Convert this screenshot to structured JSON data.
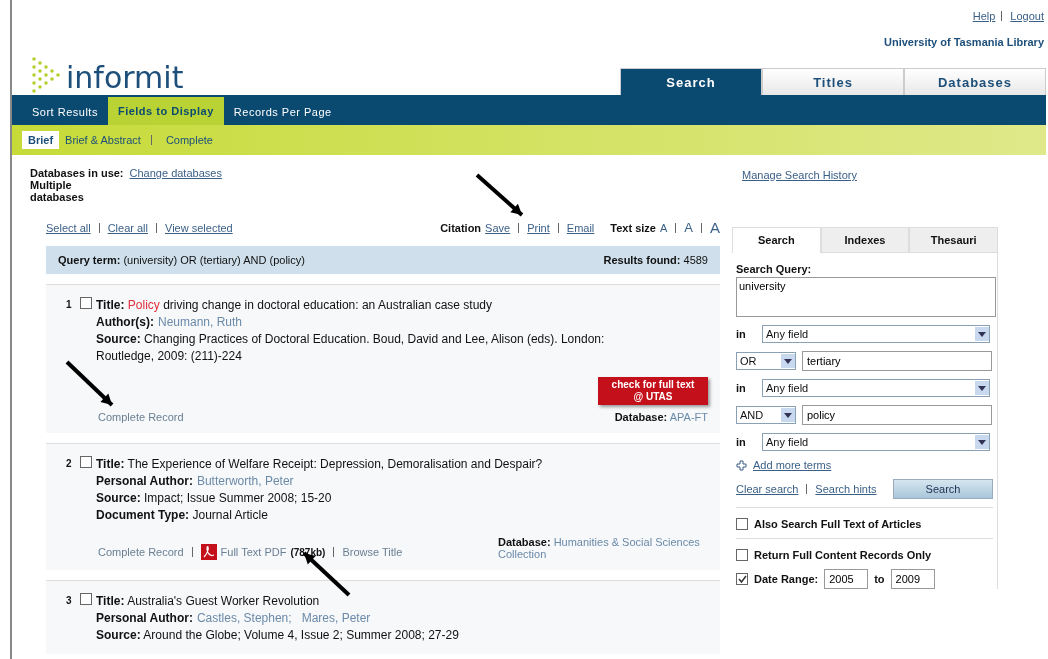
{
  "header": {
    "logo": "informit",
    "links": [
      "Help",
      "Logout"
    ],
    "library": "University of Tasmania Library",
    "tabs": [
      {
        "label": "Search",
        "selected": true
      },
      {
        "label": "Titles",
        "selected": false
      },
      {
        "label": "Databases",
        "selected": false
      }
    ]
  },
  "nav_tabs": [
    {
      "label": "Sort Results",
      "selected": false
    },
    {
      "label": "Fields to Display",
      "selected": true
    },
    {
      "label": "Records Per Page",
      "selected": false
    }
  ],
  "field_options": [
    {
      "label": "Brief",
      "selected": true
    },
    {
      "label": "Brief & Abstract",
      "selected": false
    },
    {
      "label": "Complete",
      "selected": false
    }
  ],
  "databases": {
    "label": "Databases in use:",
    "link": "Change databases",
    "value": "Multiple databases"
  },
  "selection_links": [
    "Select all",
    "Clear all",
    "View selected"
  ],
  "citation": {
    "label": "Citation",
    "links": [
      "Save",
      "Print",
      "Email"
    ]
  },
  "text_size": {
    "label": "Text size",
    "options": [
      "A",
      "A",
      "A"
    ]
  },
  "query_bar": {
    "label": "Query term:",
    "value": "(university) OR (tertiary) AND (policy)",
    "results_label": "Results found:",
    "results_value": "4589"
  },
  "results": [
    {
      "number": "1",
      "checked": false,
      "fields": [
        {
          "kind": "title",
          "label": "Title:",
          "parts": [
            {
              "text": "Policy",
              "highlight": true
            },
            {
              "text": " driving change in doctoral education: an Australian case study",
              "highlight": false
            }
          ]
        },
        {
          "kind": "links",
          "label": "Author(s):",
          "items": [
            "Neumann, Ruth"
          ]
        },
        {
          "kind": "text",
          "label": "Source:",
          "value": "Changing Practices of Doctoral Education. Boud, David and Lee, Alison (eds). London: Routledge, 2009: (211)-224"
        }
      ],
      "actions": [
        {
          "kind": "link",
          "label": "Complete Record"
        }
      ],
      "fulltext_button": "check for full text @ UTAS",
      "database_label": "Database:",
      "database": "APA-FT"
    },
    {
      "number": "2",
      "checked": false,
      "fields": [
        {
          "kind": "title",
          "label": "Title:",
          "parts": [
            {
              "text": "The Experience of Welfare Receipt: Depression, Demoralisation and Despair?",
              "highlight": false
            }
          ]
        },
        {
          "kind": "links",
          "label": "Personal Author:",
          "items": [
            "Butterworth, Peter"
          ]
        },
        {
          "kind": "text",
          "label": "Source:",
          "value": "Impact; Issue Summer 2008; 15-20"
        },
        {
          "kind": "text",
          "label": "Document Type:",
          "value": "Journal Article"
        }
      ],
      "actions": [
        {
          "kind": "link",
          "label": "Complete Record"
        },
        {
          "kind": "pdf",
          "label": "Full Text PDF",
          "size": "(787kb)"
        },
        {
          "kind": "link",
          "label": "Browse Title"
        }
      ],
      "database_label": "Database:",
      "database": "Humanities & Social Sciences Collection"
    },
    {
      "number": "3",
      "checked": false,
      "fields": [
        {
          "kind": "title",
          "label": "Title:",
          "parts": [
            {
              "text": "Australia's Guest Worker Revolution",
              "highlight": false
            }
          ]
        },
        {
          "kind": "links",
          "label": "Personal Author:",
          "items": [
            "Castles, Stephen;",
            "Mares, Peter"
          ]
        },
        {
          "kind": "text",
          "label": "Source:",
          "value": "Around the Globe; Volume 4, Issue 2; Summer 2008; 27-29"
        }
      ]
    }
  ],
  "side": {
    "manage_link": "Manage Search History",
    "tabs": [
      {
        "label": "Search",
        "selected": true
      },
      {
        "label": "Indexes",
        "selected": false
      },
      {
        "label": "Thesauri",
        "selected": false
      }
    ],
    "query_label": "Search Query:",
    "query_value": "university",
    "rows": [
      {
        "kind": "in",
        "label": "in",
        "value": "Any field"
      },
      {
        "kind": "term",
        "operator": "OR",
        "value": "tertiary"
      },
      {
        "kind": "in",
        "label": "in",
        "value": "Any field"
      },
      {
        "kind": "term",
        "operator": "AND",
        "value": "policy"
      },
      {
        "kind": "in",
        "label": "in",
        "value": "Any field"
      }
    ],
    "add_more": "Add more terms",
    "links": [
      "Clear search",
      "Search hints"
    ],
    "button": "Search",
    "options": [
      {
        "kind": "check",
        "label": "Also Search Full Text of Articles",
        "checked": false
      },
      {
        "kind": "check",
        "label": "Return Full Content Records Only",
        "checked": false
      },
      {
        "kind": "date",
        "label": "Date Range:",
        "checked": true,
        "from": "2005",
        "to_label": "to",
        "to": "2009"
      }
    ]
  }
}
